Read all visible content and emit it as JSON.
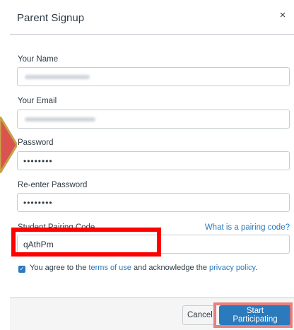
{
  "dialog": {
    "title": "Parent Signup",
    "close_glyph": "×"
  },
  "form": {
    "name_label": "Your Name",
    "email_label": "Your Email",
    "password_label": "Password",
    "password_value": "••••••••",
    "reenter_label": "Re-enter Password",
    "reenter_value": "••••••••",
    "pairing_label": "Student Pairing Code",
    "pairing_link": "What is a pairing code?",
    "pairing_value": "qAthPm",
    "agree_prefix": "You agree to the ",
    "terms_link": "terms of use",
    "agree_middle": " and acknowledge the ",
    "privacy_link": "privacy policy",
    "agree_suffix": "."
  },
  "footer": {
    "cancel_label": "Cancel",
    "start_label": "Start Participating"
  },
  "colors": {
    "link": "#2b7abc",
    "primary_button": "#2b7abc",
    "annotation_box": "#ff0000",
    "arrow_fill": "#d9534f",
    "arrow_border": "#c8a24a"
  },
  "icons": {
    "close": "close-icon",
    "checkbox": "checkbox-checked-icon"
  }
}
